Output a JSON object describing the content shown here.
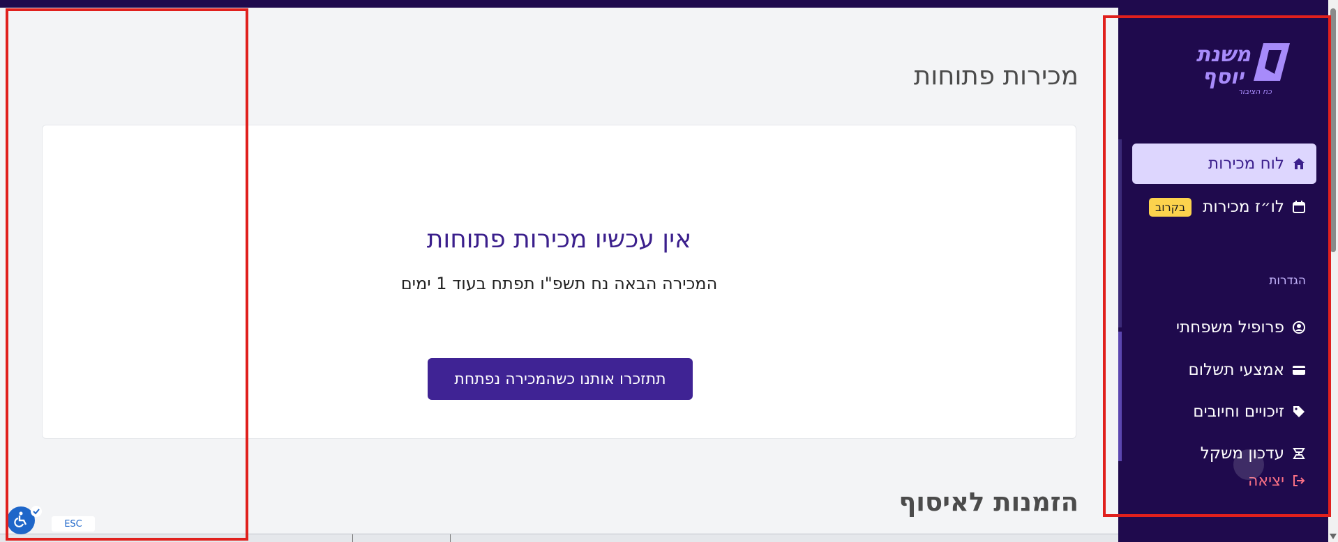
{
  "main": {
    "title": "מכירות פתוחות",
    "empty_card": {
      "heading": "אין עכשיו מכירות פתוחות",
      "subtext": "המכירה הבאה נח תשפ\"ו תפתח בעוד 1 ימים",
      "button_label": "תתזכרו אותנו כשהמכירה נפתחת"
    },
    "second_section_title": "הזמנות לאיסוף"
  },
  "sidebar": {
    "logo_text": "משנת יוסף",
    "logo_tagline": "כח הציבור",
    "nav": [
      {
        "label": "לוח מכירות",
        "icon": "home-icon",
        "active": true
      },
      {
        "label": "לו״ז מכירות",
        "icon": "calendar-icon",
        "badge": "בקרוב"
      }
    ],
    "settings_label": "הגדרות",
    "settings_items": [
      {
        "label": "פרופיל משפחתי",
        "icon": "user-circle-icon"
      },
      {
        "label": "אמצעי תשלום",
        "icon": "credit-card-icon"
      },
      {
        "label": "זיכויים וחיובים",
        "icon": "tag-icon"
      },
      {
        "label": "עדכון משקל",
        "icon": "scale-icon"
      }
    ],
    "logout_label": "יציאה"
  },
  "accessibility": {
    "esc_label": "ESC"
  },
  "colors": {
    "sidebar_bg": "#1f0a4d",
    "accent": "#3f2394",
    "active_nav_bg": "#ddd6fe",
    "badge_bg": "#fcd34d",
    "logout": "#fb7185",
    "highlight": "#e0201d"
  }
}
